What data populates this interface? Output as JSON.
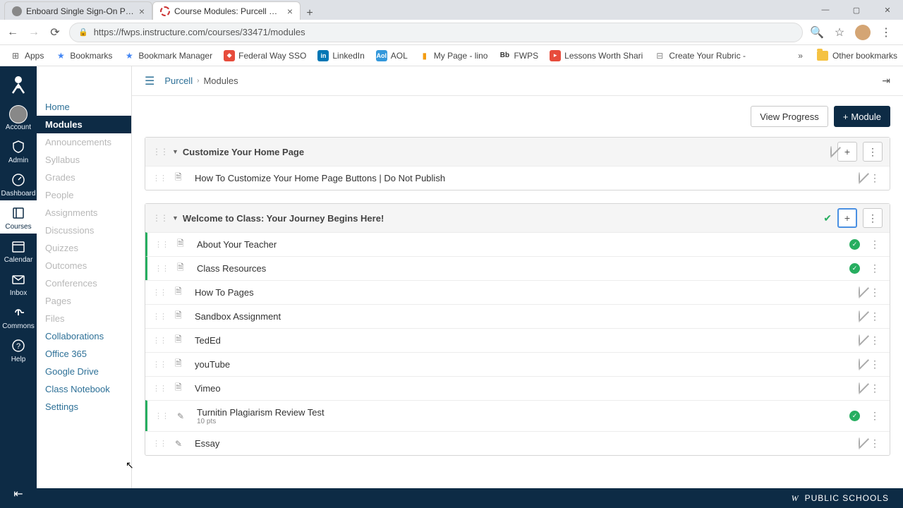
{
  "browser": {
    "tabs": [
      {
        "title": "Enboard Single Sign-On Portal",
        "active": false
      },
      {
        "title": "Course Modules: Purcell Sandbo",
        "active": true
      }
    ],
    "url": "https://fwps.instructure.com/courses/33471/modules",
    "bookmarks": [
      {
        "label": "Apps",
        "icon": "apps"
      },
      {
        "label": "Bookmarks",
        "icon": "star"
      },
      {
        "label": "Bookmark Manager",
        "icon": "star"
      },
      {
        "label": "Federal Way SSO",
        "icon": "fed"
      },
      {
        "label": "LinkedIn",
        "icon": "li"
      },
      {
        "label": "AOL",
        "icon": "aol"
      },
      {
        "label": "My Page - lino",
        "icon": "lino"
      },
      {
        "label": "FWPS",
        "icon": "bb"
      },
      {
        "label": "Lessons Worth Shari",
        "icon": "less"
      },
      {
        "label": "Create Your Rubric -",
        "icon": "rub"
      }
    ],
    "other_bookmarks": "Other bookmarks"
  },
  "global_nav": [
    {
      "key": "account",
      "label": "Account"
    },
    {
      "key": "admin",
      "label": "Admin"
    },
    {
      "key": "dashboard",
      "label": "Dashboard"
    },
    {
      "key": "courses",
      "label": "Courses",
      "active": true
    },
    {
      "key": "calendar",
      "label": "Calendar"
    },
    {
      "key": "inbox",
      "label": "Inbox"
    },
    {
      "key": "commons",
      "label": "Commons"
    },
    {
      "key": "help",
      "label": "Help"
    }
  ],
  "breadcrumb": {
    "course": "Purcell",
    "page": "Modules"
  },
  "course_nav": [
    {
      "label": "Home",
      "state": "enabled"
    },
    {
      "label": "Modules",
      "state": "active"
    },
    {
      "label": "Announcements",
      "state": "disabled"
    },
    {
      "label": "Syllabus",
      "state": "disabled"
    },
    {
      "label": "Grades",
      "state": "disabled"
    },
    {
      "label": "People",
      "state": "disabled"
    },
    {
      "label": "Assignments",
      "state": "disabled"
    },
    {
      "label": "Discussions",
      "state": "disabled"
    },
    {
      "label": "Quizzes",
      "state": "disabled"
    },
    {
      "label": "Outcomes",
      "state": "disabled"
    },
    {
      "label": "Conferences",
      "state": "disabled"
    },
    {
      "label": "Pages",
      "state": "disabled"
    },
    {
      "label": "Files",
      "state": "disabled"
    },
    {
      "label": "Collaborations",
      "state": "enabled"
    },
    {
      "label": "Office 365",
      "state": "enabled"
    },
    {
      "label": "Google Drive",
      "state": "enabled"
    },
    {
      "label": "Class Notebook",
      "state": "enabled"
    },
    {
      "label": "Settings",
      "state": "enabled"
    }
  ],
  "actions": {
    "view_progress": "View Progress",
    "add_module": "Module"
  },
  "modules": [
    {
      "title": "Customize Your Home Page",
      "published": false,
      "add_highlight": false,
      "items": [
        {
          "title": "How To Customize Your Home Page Buttons | Do Not Publish",
          "type": "page",
          "published": false
        }
      ]
    },
    {
      "title": "Welcome to Class: Your Journey Begins Here!",
      "published": true,
      "add_highlight": true,
      "items": [
        {
          "title": "About Your Teacher",
          "type": "page",
          "published": true
        },
        {
          "title": "Class Resources",
          "type": "page",
          "published": true
        },
        {
          "title": "How To Pages",
          "type": "page",
          "published": false
        },
        {
          "title": "Sandbox Assignment",
          "type": "page",
          "published": false
        },
        {
          "title": "TedEd",
          "type": "page",
          "published": false
        },
        {
          "title": "youTube",
          "type": "page",
          "published": false
        },
        {
          "title": "Vimeo",
          "type": "page",
          "published": false
        },
        {
          "title": "Turnitin Plagiarism Review Test",
          "type": "assignment",
          "published": true,
          "sub": "10 pts"
        },
        {
          "title": "Essay",
          "type": "assignment",
          "published": false
        }
      ]
    }
  ],
  "footer": {
    "org": "PUBLIC SCHOOLS",
    "logo": "W"
  }
}
